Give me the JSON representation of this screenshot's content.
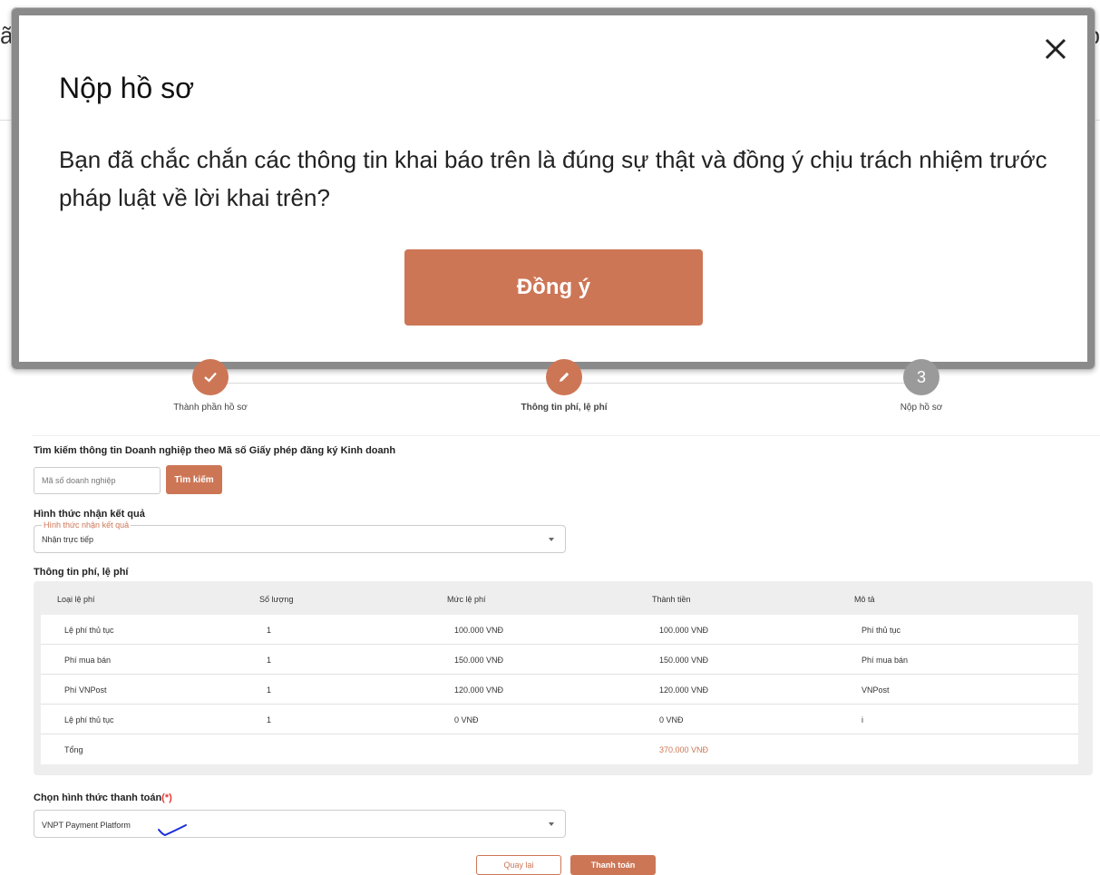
{
  "modal": {
    "title": "Nộp hồ sơ",
    "message": "Bạn đã chắc chắn các thông tin khai báo trên là đúng sự thật và đồng ý chịu trách nhiệm trước pháp luật về lời khai trên?",
    "confirm_label": "Đồng ý"
  },
  "background": {
    "fragment_left": "ã",
    "fragment_right": "p"
  },
  "stepper": {
    "steps": [
      {
        "label": "Thành phần hồ sơ",
        "state": "done",
        "icon": "check-icon"
      },
      {
        "label": "Thông tin phí, lệ phí",
        "state": "active",
        "icon": "pencil-icon"
      },
      {
        "label": "Nộp hồ sơ",
        "state": "pending",
        "number": "3"
      }
    ]
  },
  "search": {
    "section_label": "Tìm kiếm thông tin Doanh nghiệp theo Mã số Giấy phép đăng ký Kinh doanh",
    "placeholder": "Mã số doanh nghiệp",
    "button_label": "Tìm kiếm"
  },
  "result_method": {
    "section_label": "Hình thức nhận kết quả",
    "field_label": "Hình thức nhận kết quả",
    "value": "Nhận trực tiếp"
  },
  "fees": {
    "section_label": "Thông tin phí, lệ phí",
    "headers": [
      "Loại lệ phí",
      "Số lượng",
      "Mức lệ phí",
      "Thành tiền",
      "Mô tả"
    ],
    "rows": [
      [
        "Lệ phí thủ tục",
        "1",
        "100.000 VNĐ",
        "100.000 VNĐ",
        "Phí thủ tục"
      ],
      [
        "Phí mua bán",
        "1",
        "150.000 VNĐ",
        "150.000 VNĐ",
        "Phí mua bán"
      ],
      [
        "Phí VNPost",
        "1",
        "120.000 VNĐ",
        "120.000 VNĐ",
        "VNPost"
      ],
      [
        "Lệ phí thủ tục",
        "1",
        "0 VNĐ",
        "0 VNĐ",
        "i"
      ]
    ],
    "total_label": "Tổng",
    "total_value": "370.000 VNĐ"
  },
  "payment": {
    "section_label": "Chọn hình thức thanh toán",
    "required_mark": "(*)",
    "value": "VNPT Payment Platform"
  },
  "actions": {
    "back_label": "Quay lại",
    "pay_label": "Thanh toán"
  },
  "colors": {
    "accent": "#cd7656",
    "pending": "#9a9a9a",
    "required": "#e53935"
  }
}
